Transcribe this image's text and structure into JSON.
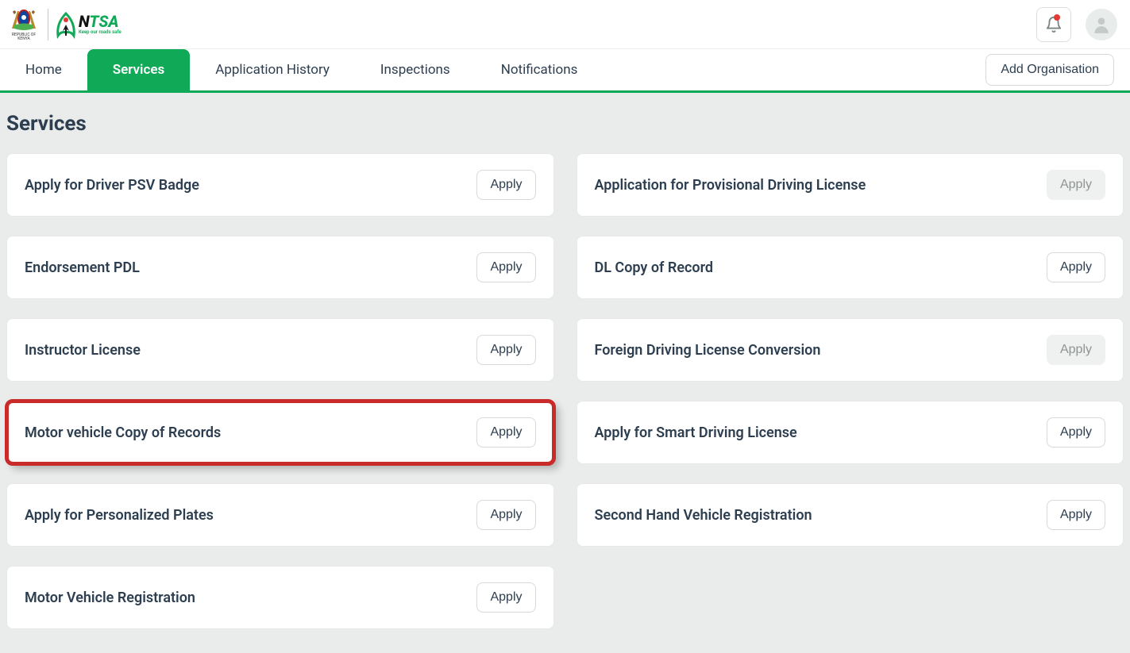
{
  "header": {
    "coat_caption": "REPUBLIC OF KENYA",
    "ntsa_name_part_n": "N",
    "ntsa_name_part_tsa": "TSA",
    "ntsa_tagline": "Keep our roads safe"
  },
  "nav": {
    "tabs": {
      "home": "Home",
      "services": "Services",
      "application_history": "Application History",
      "inspections": "Inspections",
      "notifications": "Notifications"
    },
    "add_org": "Add Organisation"
  },
  "page_title": "Services",
  "apply_label": "Apply",
  "services_left": [
    {
      "title": "Apply for Driver PSV Badge",
      "disabled": false,
      "highlighted": false
    },
    {
      "title": "Endorsement PDL",
      "disabled": false,
      "highlighted": false
    },
    {
      "title": "Instructor License",
      "disabled": false,
      "highlighted": false
    },
    {
      "title": "Motor vehicle Copy of Records",
      "disabled": false,
      "highlighted": true
    },
    {
      "title": "Apply for Personalized Plates",
      "disabled": false,
      "highlighted": false
    },
    {
      "title": "Motor Vehicle Registration",
      "disabled": false,
      "highlighted": false
    }
  ],
  "services_right": [
    {
      "title": "Application for Provisional Driving License",
      "disabled": true,
      "highlighted": false
    },
    {
      "title": "DL Copy of Record",
      "disabled": false,
      "highlighted": false
    },
    {
      "title": "Foreign Driving License Conversion",
      "disabled": true,
      "highlighted": false
    },
    {
      "title": "Apply for Smart Driving License",
      "disabled": false,
      "highlighted": false
    },
    {
      "title": "Second Hand Vehicle Registration",
      "disabled": false,
      "highlighted": false
    }
  ]
}
